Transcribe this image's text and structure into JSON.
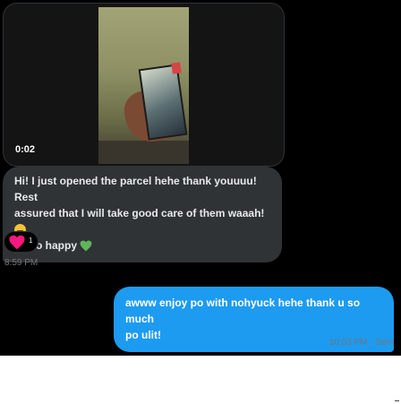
{
  "media": {
    "duration": "0:02"
  },
  "incoming_message": {
    "line1": "Hi! I just opened the parcel hehe thank youuuu! Rest",
    "line2": "assured that I will take good care of them waaah!",
    "line3": "so happy",
    "emojis": [
      "loudly-crying-face",
      "two-hearts",
      "green-heart"
    ],
    "time": "8:59 PM"
  },
  "reaction": {
    "emoji": "red-heart",
    "count": "1"
  },
  "outgoing_message": {
    "line1": "awww enjoy po with nohyuck hehe thank u so much",
    "line2": "po ulit!",
    "time": "10:03 PM",
    "separator": "·",
    "status": "Sent"
  },
  "colors": {
    "chat_background": "#000000",
    "incoming_bubble": "#2f3336",
    "outgoing_bubble": "#1d9bf0",
    "muted_text": "#71767b",
    "heart": "#f91880",
    "green_heart": "#5fb55a"
  }
}
